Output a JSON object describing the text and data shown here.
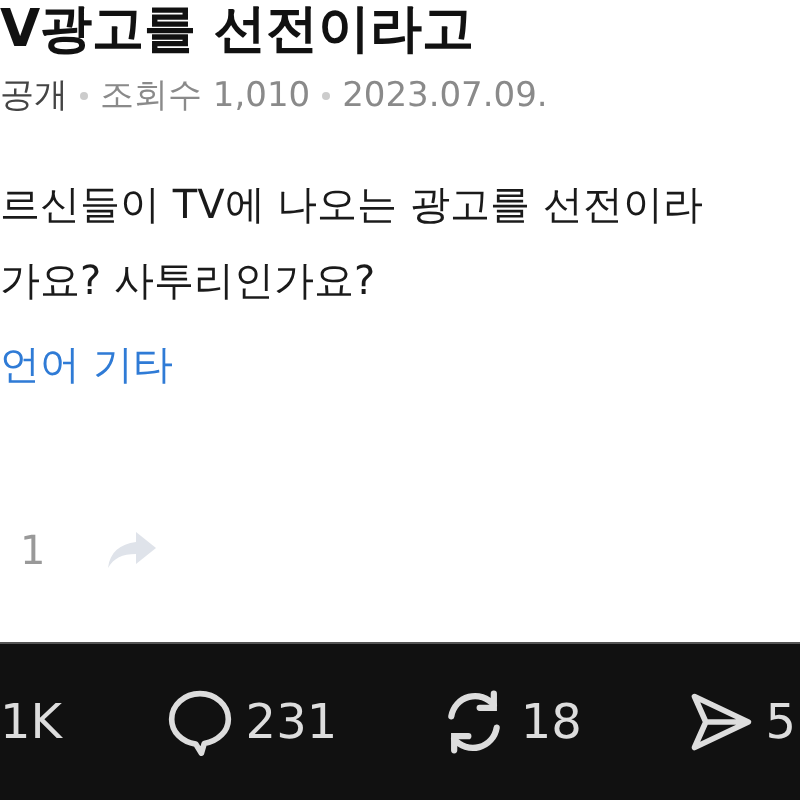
{
  "post": {
    "title": "V광고를 선전이라고",
    "meta": [
      "공개",
      "조회수 1,010",
      "2023.07.09."
    ],
    "body": [
      "르신들이 TV에 나오는 광고를 선전이라",
      "가요? 사투리인가요?"
    ],
    "tag": "언어 기타",
    "likes": "1"
  },
  "action_bar": [
    {
      "kind": "views",
      "count": "1K"
    },
    {
      "kind": "comment",
      "count": "231"
    },
    {
      "kind": "repost",
      "count": "18"
    },
    {
      "kind": "send",
      "count": "5"
    }
  ]
}
